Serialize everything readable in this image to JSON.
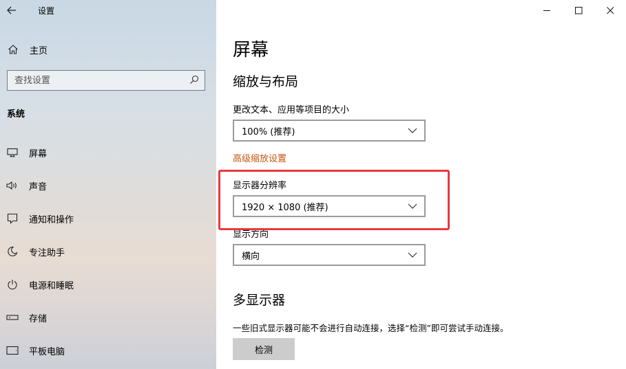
{
  "window": {
    "title": "设置",
    "controls": [
      "minimize",
      "maximize",
      "close"
    ]
  },
  "sidebar": {
    "home_label": "主页",
    "search_placeholder": "查找设置",
    "section_label": "系统",
    "items": [
      {
        "label": "屏幕",
        "icon": "monitor-icon"
      },
      {
        "label": "声音",
        "icon": "speaker-icon"
      },
      {
        "label": "通知和操作",
        "icon": "notification-icon"
      },
      {
        "label": "专注助手",
        "icon": "moon-icon"
      },
      {
        "label": "电源和睡眠",
        "icon": "power-icon"
      },
      {
        "label": "存储",
        "icon": "storage-icon"
      },
      {
        "label": "平板电脑",
        "icon": "tablet-icon"
      }
    ]
  },
  "main": {
    "page_title": "屏幕",
    "scale_section": {
      "heading": "缩放与布局",
      "text_size_label": "更改文本、应用等项目的大小",
      "text_size_value": "100% (推荐)",
      "advanced_link": "高级缩放设置",
      "resolution_label": "显示器分辨率",
      "resolution_value": "1920 × 1080 (推荐)",
      "orientation_label": "显示方向",
      "orientation_value": "横向"
    },
    "multi_section": {
      "heading": "多显示器",
      "description": "一些旧式显示器可能不会进行自动连接，选择“检测”即可尝试手动连接。",
      "detect_label": "检测"
    }
  },
  "colors": {
    "link": "#c75510",
    "highlight": "#e8383d",
    "button_bg": "#cccccc"
  }
}
